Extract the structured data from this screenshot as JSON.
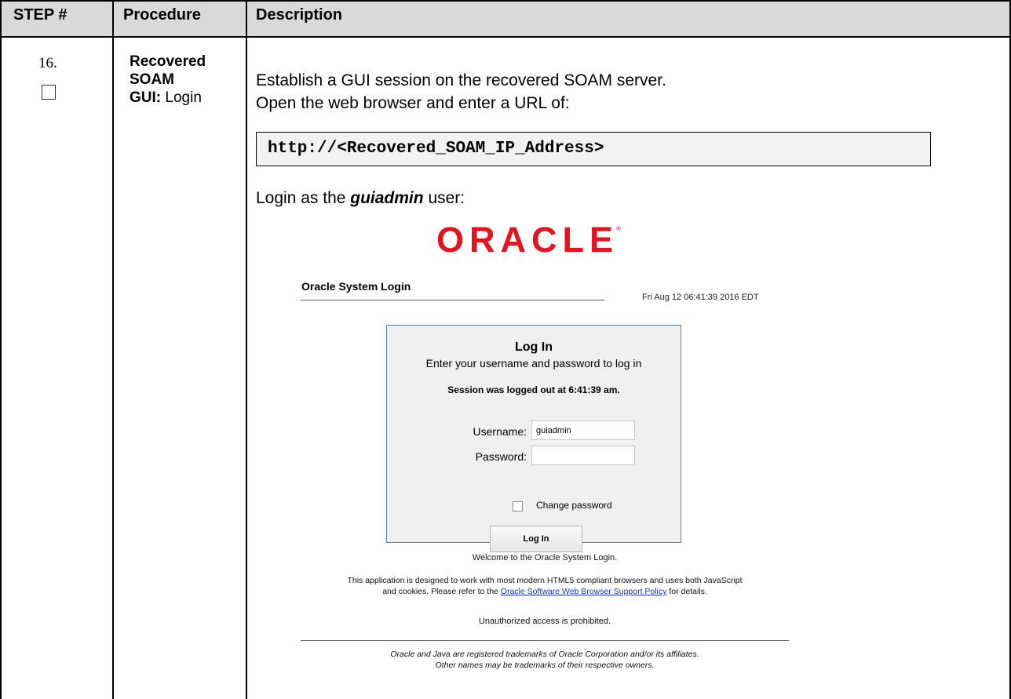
{
  "table": {
    "headers": [
      "STEP #",
      "Procedure",
      "Description"
    ],
    "step_number": "16.",
    "procedure": {
      "bold": "Recovered SOAM",
      "bold2": "GUI:",
      "rest": "Login"
    }
  },
  "description": {
    "line1": "Establish a GUI session on the recovered SOAM server.",
    "line2": "Open the web browser and enter a URL of:",
    "url": "http://<Recovered_SOAM_IP_Address>",
    "login_prefix": "Login as the ",
    "login_user": "guiadmin",
    "login_suffix": " user:"
  },
  "oracle_login": {
    "logo_text": "ORACLE",
    "title": "Oracle System Login",
    "date": "Fri Aug 12 06:41:39 2016 EDT",
    "box_title": "Log In",
    "box_subtitle": "Enter your username and password to log in",
    "session_msg": "Session was logged out at 6:41:39 am.",
    "username_label": "Username:",
    "username_value": "guiadmin",
    "password_label": "Password:",
    "password_value": "",
    "change_password_label": "Change password",
    "change_password_checked": false,
    "login_button": "Log In",
    "welcome": "Welcome to the Oracle System Login.",
    "policy_line1": "This application is designed to work with most modern HTML5 compliant browsers and uses both JavaScript",
    "policy_line2_pre": "and cookies. Please refer to the ",
    "policy_link": "Oracle Software Web Browser Support Policy",
    "policy_line2_post": " for details.",
    "unauthorized": "Unauthorized access is prohibited.",
    "footer1": "Oracle and Java are registered trademarks of Oracle Corporation and/or its affiliates.",
    "footer2": "Other names may be trademarks of their respective owners.",
    "logo_color": "#e4141e",
    "link_color": "#1a33c9"
  }
}
